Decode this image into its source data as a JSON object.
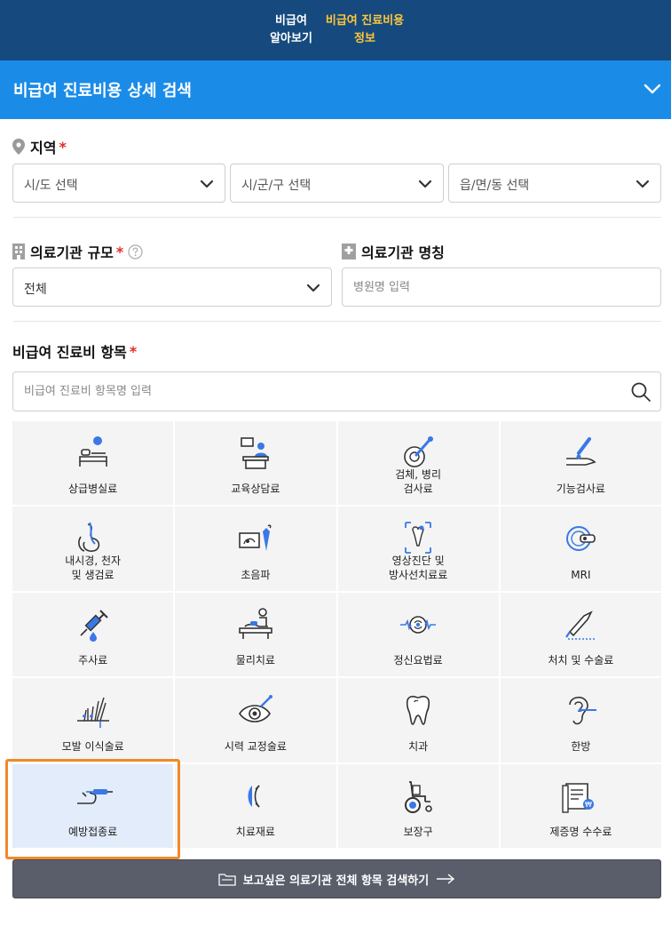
{
  "nav": {
    "first_line1": "비급여",
    "first_line2": "알아보기",
    "second_line1": "비급여 진료비용",
    "second_line2": "정보"
  },
  "header": {
    "title": "비급여 진료비용 상세 검색"
  },
  "region": {
    "label": "지역",
    "required_mark": "*",
    "sido": "시/도 선택",
    "sigungu": "시/군/구 선택",
    "dong": "읍/면/동 선택"
  },
  "scale": {
    "label": "의료기관 규모",
    "required_mark": "*",
    "value": "전체"
  },
  "hospital_name": {
    "label": "의료기관 명칭",
    "placeholder": "병원명 입력"
  },
  "items": {
    "label": "비급여 진료비 항목",
    "required_mark": "*",
    "search_placeholder": "비급여 진료비 항목명 입력",
    "categories": [
      {
        "label": "상급병실료",
        "icon": "hospital-bed-icon"
      },
      {
        "label": "교육상담료",
        "icon": "counseling-icon"
      },
      {
        "label": "검체, 병리\n검사료",
        "icon": "specimen-test-icon"
      },
      {
        "label": "기능검사료",
        "icon": "function-test-icon"
      },
      {
        "label": "내시경, 천자\n및 생검료",
        "icon": "endoscope-icon"
      },
      {
        "label": "초음파",
        "icon": "ultrasound-icon"
      },
      {
        "label": "영상진단 및\n방사선치료료",
        "icon": "xray-icon"
      },
      {
        "label": "MRI",
        "icon": "mri-icon"
      },
      {
        "label": "주사료",
        "icon": "injection-icon"
      },
      {
        "label": "물리치료",
        "icon": "physical-therapy-icon"
      },
      {
        "label": "정신요법료",
        "icon": "psychotherapy-icon"
      },
      {
        "label": "처치 및 수술료",
        "icon": "surgery-icon"
      },
      {
        "label": "모발 이식술료",
        "icon": "hair-transplant-icon"
      },
      {
        "label": "시력 교정술료",
        "icon": "eye-correction-icon"
      },
      {
        "label": "치과",
        "icon": "tooth-icon"
      },
      {
        "label": "한방",
        "icon": "acupuncture-ear-icon"
      },
      {
        "label": "예방접종료",
        "icon": "vaccination-icon",
        "selected": true
      },
      {
        "label": "치료재료",
        "icon": "treatment-material-icon"
      },
      {
        "label": "보장구",
        "icon": "wheelchair-icon"
      },
      {
        "label": "제증명 수수료",
        "icon": "certificate-fee-icon"
      }
    ]
  },
  "bottom_button": {
    "label": "보고싶은 의료기관 전체 항목 검색하기"
  },
  "colors": {
    "nav_bg": "#164a7e",
    "nav_highlight": "#ffc63a",
    "header_bg": "#1a8ce8",
    "required": "#e02b2b",
    "icon_accent": "#3a78e6",
    "selection_outline": "#f08a2b",
    "button_bg": "#595e6a"
  }
}
